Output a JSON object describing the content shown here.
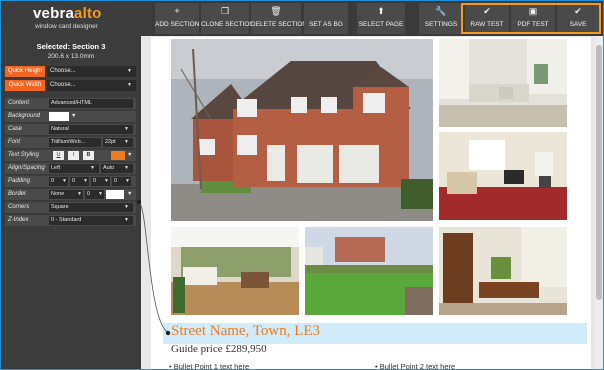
{
  "logo": {
    "main": "vebra",
    "accent": "alto",
    "sub": "window card designer"
  },
  "toolbar": [
    {
      "icon": "+",
      "label": "ADD SECTION"
    },
    {
      "icon": "❐",
      "label": "CLONE SECTION"
    },
    {
      "icon": "🗑",
      "label": "DELETE SECTION"
    },
    {
      "icon": "",
      "label": "SET AS BG"
    },
    {
      "icon": "⬆",
      "label": "SELECT PAGE"
    },
    {
      "icon": "🔧",
      "label": "SETTINGS"
    },
    {
      "icon": "✔",
      "label": "RAW TEST"
    },
    {
      "icon": "▣",
      "label": "PDF TEST"
    },
    {
      "icon": "✔",
      "label": "SAVE"
    }
  ],
  "selection": {
    "title": "Selected: Section 3",
    "size": "200.6 x 13.0mm"
  },
  "quick": [
    {
      "label": "Quick Height",
      "value": "Choose..."
    },
    {
      "label": "Quick Width",
      "value": "Choose..."
    }
  ],
  "props": {
    "content": {
      "label": "Content",
      "value": "Advanced/HTML"
    },
    "background": {
      "label": "Background"
    },
    "case": {
      "label": "Case",
      "value": "Natural"
    },
    "font": {
      "label": "Font",
      "family": "TitilliumWeb...",
      "size": "22pt"
    },
    "styling": {
      "label": "Text Styling",
      "u": "U",
      "i": "I",
      "b": "B"
    },
    "align": {
      "label": "Align/Spacing",
      "align": "Left",
      "spacing": "Auto"
    },
    "padding": {
      "label": "Padding",
      "values": [
        "0",
        "0",
        "0",
        "0"
      ]
    },
    "border": {
      "label": "Border",
      "style": "None",
      "width": "0"
    },
    "corners": {
      "label": "Corners",
      "value": "Square"
    },
    "zindex": {
      "label": "Z-Index",
      "value": "0 - Standard"
    }
  },
  "card": {
    "street": "Street Name, Town, LE3",
    "price": "Guide price £289,950",
    "bullets": [
      "Bullet Point 1 text here",
      "Bullet Point 2 text here"
    ]
  },
  "colors": {
    "accent": "#f29a1f",
    "quick_btn": "#f26522",
    "street": "#f07a1c",
    "frame": "#1f8fd9"
  }
}
